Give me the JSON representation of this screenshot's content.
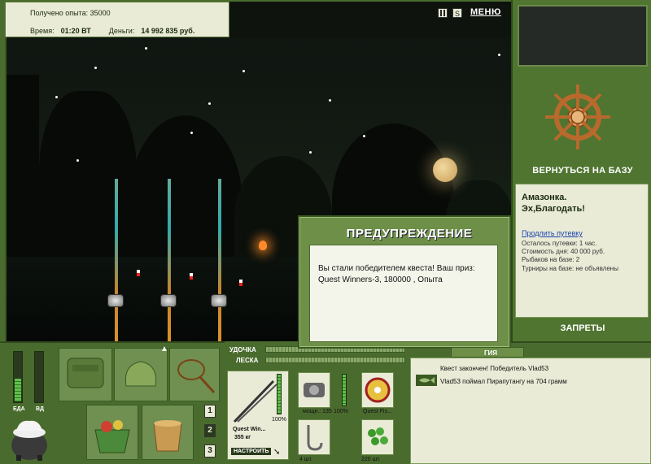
{
  "info": {
    "xp_label": "Получено опыта:",
    "xp_value": "35000",
    "time_label": "Время:",
    "time_value": "01:20 ВТ",
    "money_label": "Деньги:",
    "money_value": "14 992 835 руб."
  },
  "topbar": {
    "menu_label": "МЕНЮ",
    "pause_icon": "pause-icon",
    "sound_icon": "sound-icon"
  },
  "right_panel": {
    "back_to_base": "ВЕРНУТЬСЯ НА БАЗУ",
    "location_name": "Амазонка.",
    "location_sub": "Эх,Благодать!",
    "extend_trip": "Продлить путевку",
    "lines": [
      "Осталось путевки: 1 час.",
      "Стоимость дня: 40 000 руб.",
      "Рыбаков на базе: 2",
      "Турниры на базе: не объявлены"
    ],
    "bans_label": "ЗАПРЕТЫ"
  },
  "dialog": {
    "title": "ПРЕДУПРЕЖДЕНИЕ",
    "message": "Вы стали победителем квеста! Ваш приз: Quest Winners-3, 180000 , Опыта"
  },
  "status": {
    "food_label": "ЕДА",
    "energy_label": "ВД",
    "food_level": 0.45,
    "energy_level": 0.0
  },
  "pages": [
    "1",
    "2",
    "3"
  ],
  "gear": {
    "rod_label": "УДОЧКА",
    "line_label": "ЛЕСКА",
    "rod_name": "Quest Win...",
    "rod_weight": "355 кг",
    "rod_percent": "100%",
    "setup_button": "НАСТРОИТЬ",
    "reel_power": "мощн.: 135",
    "reel_percent": "100%",
    "line_name": "Quest Fis...",
    "hook_count": "4 шт.",
    "bait_count": "220 шт."
  },
  "log": {
    "tab_label": "ГИЯ",
    "entries": [
      "Квест закончен! Победитель Vlad53",
      "Vlad53 поймал Пирапутангу на 704 грамм"
    ]
  }
}
